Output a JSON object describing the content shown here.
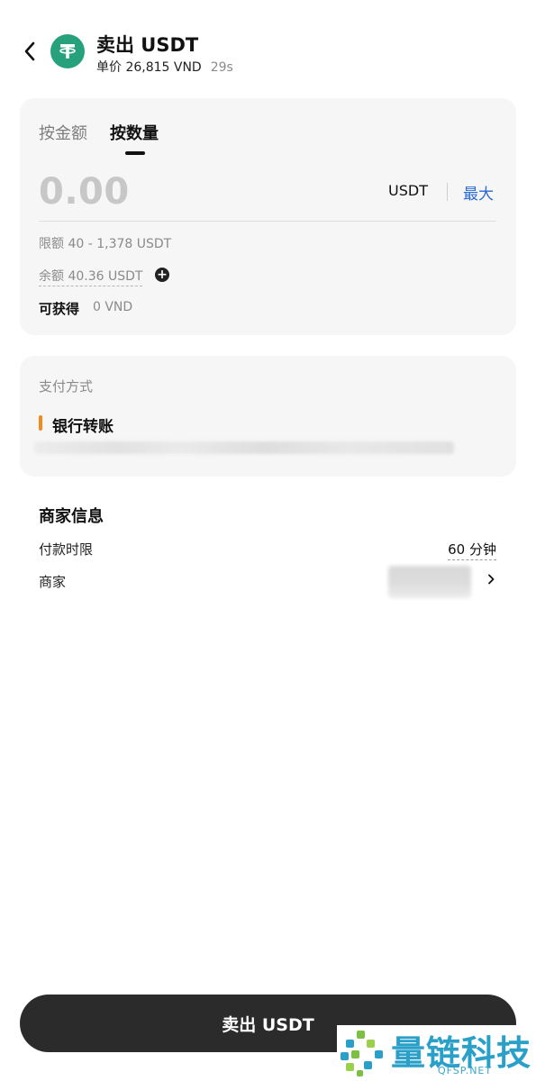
{
  "header": {
    "title": "卖出 USDT",
    "price_label": "单价 26,815 VND",
    "countdown": "29s",
    "coin_icon": "tether-icon",
    "back_icon": "chevron-left-icon"
  },
  "amount_card": {
    "tabs": [
      {
        "label": "按金额",
        "active": false
      },
      {
        "label": "按数量",
        "active": true
      }
    ],
    "input_value": "0.00",
    "unit": "USDT",
    "max_label": "最大",
    "limit_text": "限额 40 - 1,378 USDT",
    "balance_text": "余额 40.36 USDT",
    "receive_label": "可获得",
    "receive_value": "0 VND"
  },
  "payment": {
    "title": "支付方式",
    "method": "银行转账"
  },
  "merchant_info": {
    "title": "商家信息",
    "rows": [
      {
        "label": "付款时限",
        "value": "60 分钟"
      },
      {
        "label": "商家"
      }
    ]
  },
  "footer": {
    "sell_button": "卖出 USDT"
  },
  "watermark": {
    "brand": "量链科技",
    "url": "QFSP.NET"
  },
  "colors": {
    "accent_blue": "#2a6bd4",
    "tether_green": "#26a17b",
    "payment_bar": "#f08a1c",
    "button_dark": "#2b2b2b"
  }
}
